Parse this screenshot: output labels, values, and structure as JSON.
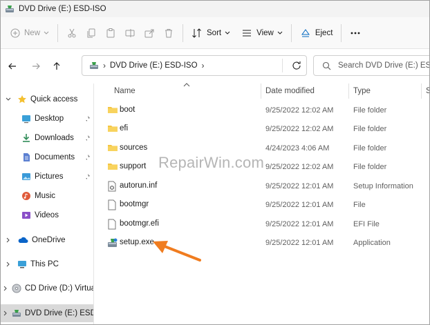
{
  "window": {
    "title": "DVD Drive (E:) ESD-ISO"
  },
  "toolbar": {
    "new_label": "New",
    "sort_label": "Sort",
    "view_label": "View",
    "eject_label": "Eject",
    "more_label": "..."
  },
  "address": {
    "crumb": "DVD Drive (E:) ESD-ISO",
    "search_placeholder": "Search DVD Drive (E:) ESD-ISO"
  },
  "nav": {
    "quick_access": "Quick access",
    "desktop": "Desktop",
    "downloads": "Downloads",
    "documents": "Documents",
    "pictures": "Pictures",
    "music": "Music",
    "videos": "Videos",
    "onedrive": "OneDrive",
    "thispc": "This PC",
    "cddrive": "CD Drive (D:) Virtual",
    "dvddrive": "DVD Drive (E:) ESD-ISO"
  },
  "columns": {
    "name": "Name",
    "date": "Date modified",
    "type": "Type",
    "size": "S"
  },
  "files": [
    {
      "name": "boot",
      "date": "9/25/2022 12:02 AM",
      "type": "File folder",
      "icon": "folder-icon"
    },
    {
      "name": "efi",
      "date": "9/25/2022 12:02 AM",
      "type": "File folder",
      "icon": "folder-icon"
    },
    {
      "name": "sources",
      "date": "4/24/2023 4:06 AM",
      "type": "File folder",
      "icon": "folder-icon"
    },
    {
      "name": "support",
      "date": "9/25/2022 12:02 AM",
      "type": "File folder",
      "icon": "folder-icon"
    },
    {
      "name": "autorun.inf",
      "date": "9/25/2022 12:01 AM",
      "type": "Setup Information",
      "icon": "settings-file-icon"
    },
    {
      "name": "bootmgr",
      "date": "9/25/2022 12:01 AM",
      "type": "File",
      "icon": "file-icon"
    },
    {
      "name": "bootmgr.efi",
      "date": "9/25/2022 12:01 AM",
      "type": "EFI File",
      "icon": "file-icon"
    },
    {
      "name": "setup.exe",
      "date": "9/25/2022 12:01 AM",
      "type": "Application",
      "icon": "setup-app-icon"
    }
  ],
  "watermark": "RepairWin.com",
  "colors": {
    "accent": "#0067c0",
    "folder": "#f4c542",
    "arrow": "#f07c1f",
    "selected": "#d9d9d9"
  }
}
